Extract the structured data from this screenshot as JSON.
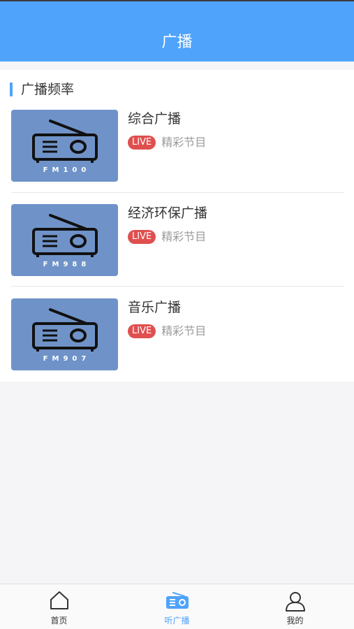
{
  "header": {
    "title": "广播"
  },
  "section": {
    "title": "广播频率"
  },
  "stations": [
    {
      "name": "综合广播",
      "frequency": "FM100",
      "badge": "LIVE",
      "desc": "精彩节目"
    },
    {
      "name": "经济环保广播",
      "frequency": "FM988",
      "badge": "LIVE",
      "desc": "精彩节目"
    },
    {
      "name": "音乐广播",
      "frequency": "FM907",
      "badge": "LIVE",
      "desc": "精彩节目"
    }
  ],
  "tabs": [
    {
      "label": "首页",
      "icon": "home-icon",
      "active": false
    },
    {
      "label": "听广播",
      "icon": "radio-icon",
      "active": true
    },
    {
      "label": "我的",
      "icon": "user-icon",
      "active": false
    }
  ],
  "colors": {
    "accent": "#4fa3fb",
    "live": "#e04f4f",
    "thumb": "#6f93c8"
  }
}
